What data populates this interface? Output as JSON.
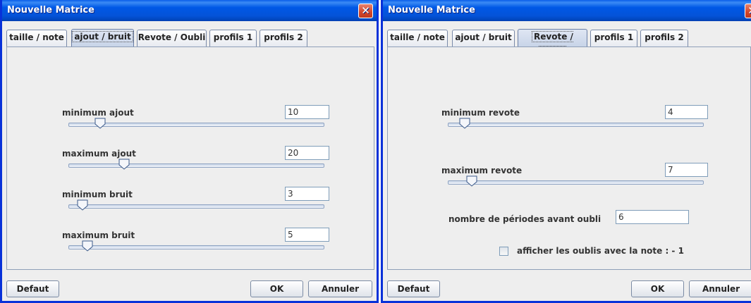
{
  "colors": {
    "titlebar": "#0054e3",
    "window_border": "#0831d9",
    "panel_bg": "#eeeeee",
    "close_button": "#d2452a"
  },
  "left": {
    "title": "Nouvelle Matrice",
    "tabs": [
      {
        "label": "taille / note"
      },
      {
        "label": "ajout / bruit",
        "active": true
      },
      {
        "label": "Revote / Oubli"
      },
      {
        "label": "profils 1"
      },
      {
        "label": "profils 2"
      }
    ],
    "rows": [
      {
        "label": "minimum ajout",
        "value": "10",
        "slider_fraction": 0.1
      },
      {
        "label": "maximum ajout",
        "value": "20",
        "slider_fraction": 0.2
      },
      {
        "label": "minimum bruit",
        "value": "3",
        "slider_fraction": 0.03
      },
      {
        "label": "maximum bruit",
        "value": "5",
        "slider_fraction": 0.05
      }
    ],
    "buttons": {
      "default": "Defaut",
      "ok": "OK",
      "cancel": "Annuler"
    }
  },
  "right": {
    "title": "Nouvelle Matrice",
    "tabs": [
      {
        "label": "taille / note"
      },
      {
        "label": "ajout / bruit"
      },
      {
        "label": "Revote / Oubli",
        "active": true
      },
      {
        "label": "profils 1"
      },
      {
        "label": "profils 2"
      }
    ],
    "rows": [
      {
        "label": "minimum revote",
        "value": "4",
        "slider_fraction": 0.04
      },
      {
        "label": "maximum revote",
        "value": "7",
        "slider_fraction": 0.07
      }
    ],
    "periods": {
      "label": "nombre de périodes avant oubli",
      "value": "6"
    },
    "checkbox": {
      "label": "afficher les oublis avec la note : - 1",
      "checked": false
    },
    "buttons": {
      "default": "Defaut",
      "ok": "OK",
      "cancel": "Annuler"
    }
  }
}
